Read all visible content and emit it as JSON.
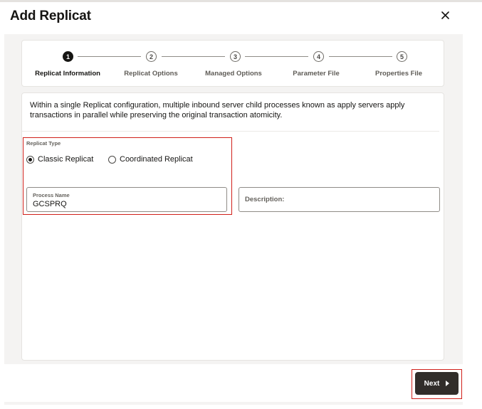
{
  "dialog": {
    "title": "Add Replicat",
    "close_icon": "close-icon"
  },
  "train": {
    "steps": [
      {
        "number": "1",
        "label": "Replicat Information",
        "state": "active"
      },
      {
        "number": "2",
        "label": "Replicat Options",
        "state": "pending"
      },
      {
        "number": "3",
        "label": "Managed Options",
        "state": "pending"
      },
      {
        "number": "4",
        "label": "Parameter File",
        "state": "pending"
      },
      {
        "number": "5",
        "label": "Properties File",
        "state": "pending"
      }
    ]
  },
  "form": {
    "intro": "Within a single Replicat configuration, multiple inbound server child processes known as apply servers apply transactions in parallel while preserving the original transaction atomicity.",
    "replicat_type": {
      "label": "Replicat Type",
      "options": [
        {
          "label": "Classic Replicat",
          "selected": true
        },
        {
          "label": "Coordinated Replicat",
          "selected": false
        }
      ]
    },
    "process_name": {
      "label": "Process Name",
      "value": "GCSPRQ"
    },
    "description": {
      "placeholder": "Description:",
      "value": ""
    }
  },
  "footer": {
    "next_label": "Next",
    "next_icon": "caret-right-icon"
  },
  "colors": {
    "highlight": "#d0201a",
    "primary_button": "#312d2a",
    "panel_background": "#f4f3f2"
  }
}
